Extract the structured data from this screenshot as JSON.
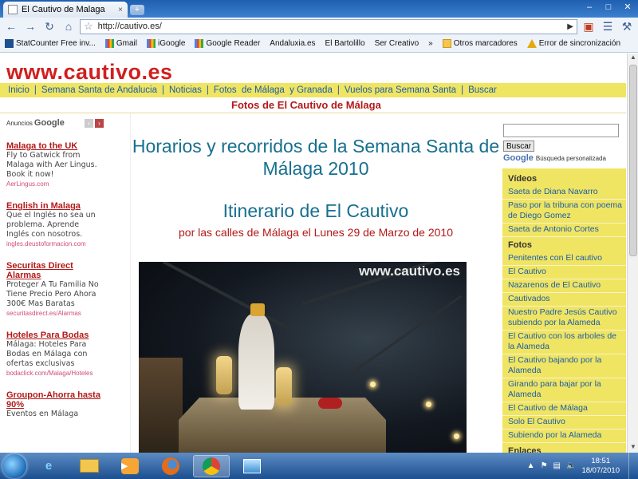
{
  "browser": {
    "tab_title": "El Cautivo de Malaga",
    "tab_close": "×",
    "new_tab": "+",
    "url": "http://cautivo.es/",
    "window_buttons": [
      "–",
      "□",
      "✕"
    ]
  },
  "bookmarks": [
    {
      "label": "StatCounter Free inv...",
      "icon": "statcounter-icon"
    },
    {
      "label": "Gmail",
      "icon": "google-icon"
    },
    {
      "label": "iGoogle",
      "icon": "google-icon"
    },
    {
      "label": "Google Reader",
      "icon": "google-icon"
    },
    {
      "label": "Andaluxia.es",
      "icon": "page-icon"
    },
    {
      "label": "El Bartolillo",
      "icon": "page-icon"
    },
    {
      "label": "Ser Creativo",
      "icon": "page-icon"
    },
    {
      "label": "»",
      "icon": ""
    },
    {
      "label": "Otros marcadores",
      "icon": "folder-icon"
    },
    {
      "label": "Error de sincronización",
      "icon": "warning-icon"
    }
  ],
  "site": {
    "logo": "www.cautivo.es",
    "nav": [
      {
        "label": "Inicio"
      },
      {
        "label": "Semana Santa de Andalucia"
      },
      {
        "label": "Noticias"
      },
      {
        "label": "Fotos  de Málaga  y Granada"
      },
      {
        "label": "Vuelos para Semana Santa"
      },
      {
        "label": "Buscar"
      }
    ],
    "photos_link": "Fotos de El Cautivo de Málaga"
  },
  "ads": {
    "label": "Anuncios",
    "google": "Google",
    "items": [
      {
        "title": "Malaga to the UK",
        "body": "Fly to Gatwick from Malaga with Aer Lingus. Book it now!",
        "url": "AerLingus.com"
      },
      {
        "title": "English in Malaga",
        "body": "Que el Inglés no sea un problema. Aprende Inglés con nosotros.",
        "url": "ingles.deustoformacion.com"
      },
      {
        "title": "Securitas Direct Alarmas",
        "body": "Proteger A Tu Familia No Tiene Precio Pero Ahora 300€ Mas Baratas",
        "url": "securitasdirect.es/Alarmas"
      },
      {
        "title": "Hoteles Para Bodas",
        "body": "Málaga: Hoteles Para Bodas en Málaga con ofertas exclusivas",
        "url": "bodaclick.com/Malaga/Hoteles"
      },
      {
        "title": "Groupon-Ahorra hasta 90%",
        "body": "Eventos en Málaga",
        "url": ""
      }
    ]
  },
  "main": {
    "heading": "Horarios y recorridos de la Semana Santa de Málaga 2010",
    "subheading": "Itinerario de El Cautivo",
    "route_text": "por las calles de Málaga el Lunes 29 de Marzo de 2010",
    "photo_watermark": "www.cautivo.es"
  },
  "sidebar": {
    "search_button": "Buscar",
    "google": "Google",
    "custom_search": "Búsqueda personalizada",
    "sections": [
      {
        "title": "Vídeos",
        "links": [
          "Saeta de Diana Navarro",
          "Paso por la tribuna con poema de Diego Gomez",
          "Saeta de Antonio Cortes"
        ]
      },
      {
        "title": "Fotos",
        "links": [
          "Penitentes con El cautivo",
          "El Cautivo",
          "Nazarenos de El Cautivo",
          "Cautivados",
          "Nuestro Padre Jesús Cautivo subiendo por la Alameda",
          "El Cautivo con los arboles de la Alameda",
          "El Cautivo bajando por la Alameda",
          "Girando para bajar por la Alameda",
          "El Cautivo de Málaga",
          "Solo El Cautivo",
          "Subiendo por la Alameda"
        ]
      },
      {
        "title": "Enlaces",
        "links": []
      }
    ]
  },
  "taskbar": {
    "time": "18:51",
    "date": "18/07/2010"
  },
  "colors": {
    "brand_red": "#d21e1e",
    "nav_yellow": "#f0e463",
    "link_blue": "#1a5ea8",
    "heading_teal": "#17708f"
  }
}
